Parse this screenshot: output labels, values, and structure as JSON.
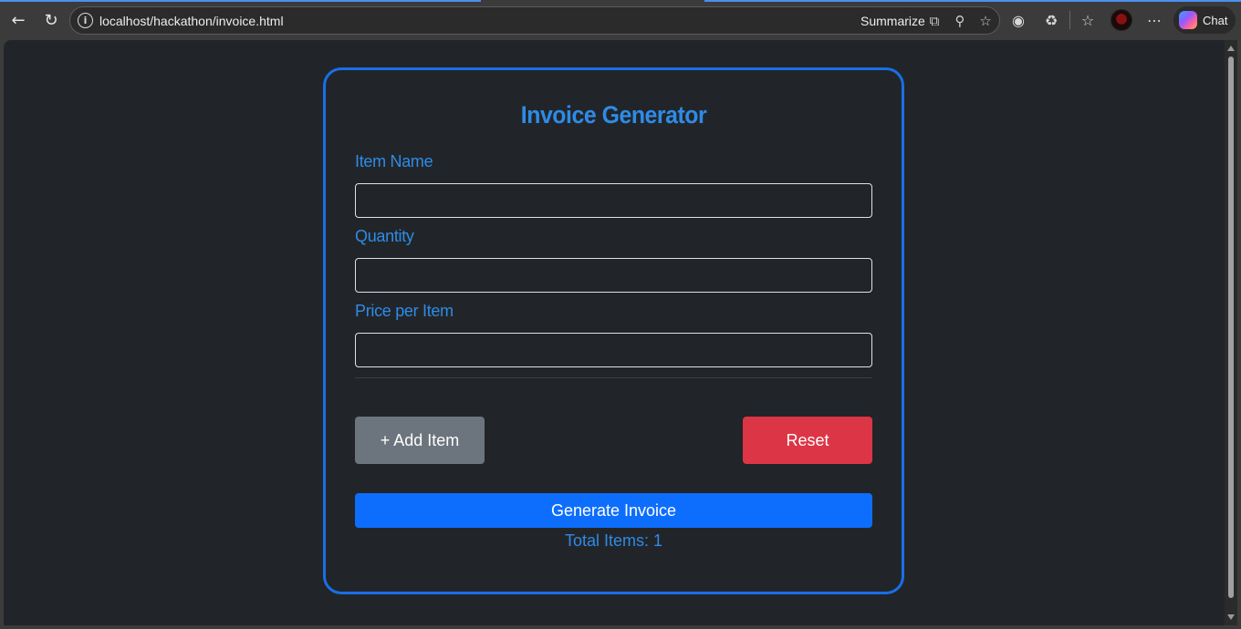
{
  "browser": {
    "url": "localhost/hackathon/invoice.html",
    "summarize_label": "Summarize",
    "chat_label": "Chat",
    "icons": [
      "back-icon",
      "refresh-icon",
      "info-icon",
      "copilot-summarize-icon",
      "zoom-icon",
      "favorite-star-icon",
      "screenshot-icon",
      "extensions-icon",
      "favorites-icon",
      "profile-avatar",
      "more-icon",
      "copilot-icon"
    ]
  },
  "app": {
    "title": "Invoice Generator",
    "fields": [
      {
        "label": "Item Name",
        "value": "",
        "placeholder": ""
      },
      {
        "label": "Quantity",
        "value": "",
        "placeholder": ""
      },
      {
        "label": "Price per Item",
        "value": "",
        "placeholder": ""
      }
    ],
    "add_button": "+ Add Item",
    "reset_button": "Reset",
    "generate_button": "Generate Invoice",
    "total_text": "Total Items: 1"
  },
  "colors": {
    "accent": "#2f8be6",
    "card_border": "#1a6ee8",
    "background": "#212529",
    "add_button": "#6c757d",
    "reset_button": "#dc3545",
    "generate_button": "#0d6efd"
  }
}
